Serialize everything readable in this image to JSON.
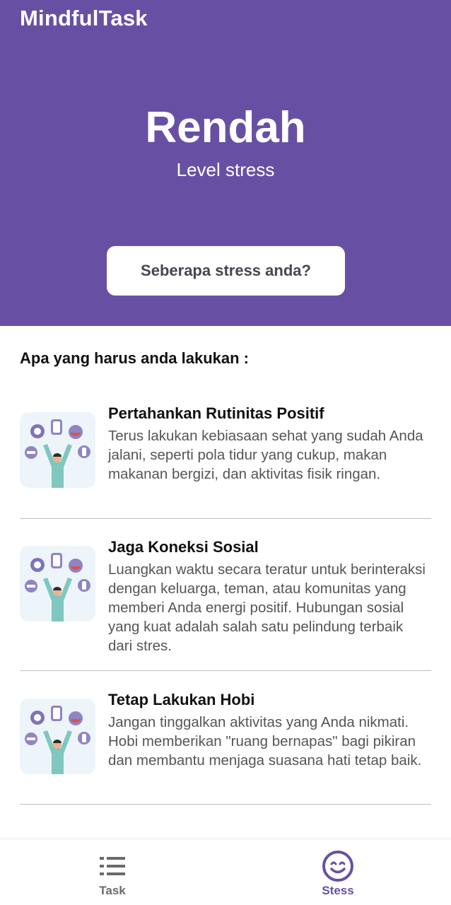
{
  "app": {
    "title": "MindfulTask"
  },
  "stress": {
    "level": "Rendah",
    "label": "Level stress",
    "button_label": "Seberapa stress anda?"
  },
  "section_title": "Apa yang harus anda lakukan :",
  "tips": [
    {
      "title": "Pertahankan Rutinitas Positif",
      "description": "Terus lakukan kebiasaan sehat yang sudah Anda jalani, seperti pola tidur yang cukup, makan makanan bergizi, dan aktivitas fisik ringan."
    },
    {
      "title": "Jaga Koneksi Sosial",
      "description": "Luangkan waktu secara teratur untuk berinteraksi dengan keluarga, teman, atau komunitas yang memberi Anda energi positif. Hubungan sosial yang kuat adalah salah satu pelindung terbaik dari stres."
    },
    {
      "title": "Tetap Lakukan Hobi",
      "description": "Jangan tinggalkan aktivitas yang Anda nikmati. Hobi memberikan \"ruang bernapas\" bagi pikiran dan membantu menjaga suasana hati tetap baik."
    }
  ],
  "nav": {
    "items": [
      {
        "label": "Task",
        "icon": "list-icon",
        "active": false
      },
      {
        "label": "Stess",
        "icon": "smile-icon",
        "active": true
      }
    ]
  },
  "colors": {
    "primary": "#6750A4",
    "nav_inactive": "#6b6b6b",
    "illustration_bg": "#EEF5FA"
  }
}
